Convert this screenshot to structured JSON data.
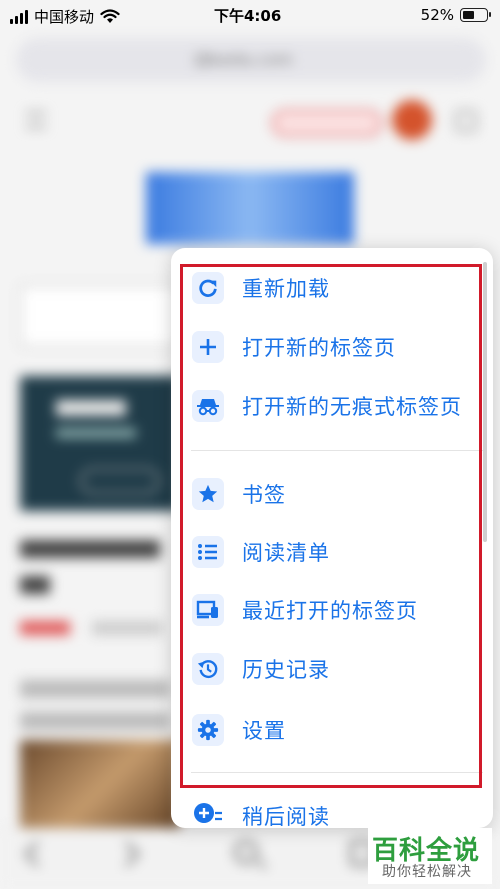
{
  "status_bar": {
    "carrier": "中国移动",
    "time": "下午4:06",
    "battery_level": "52%",
    "battery_fraction": 0.52
  },
  "background_page": {
    "url": "baidu.com"
  },
  "menu": {
    "items": [
      {
        "label": "重新加载",
        "icon": "reload-icon"
      },
      {
        "label": "打开新的标签页",
        "icon": "plus-icon"
      },
      {
        "label": "打开新的无痕式标签页",
        "icon": "incognito-icon"
      },
      {
        "label": "书签",
        "icon": "star-icon"
      },
      {
        "label": "阅读清单",
        "icon": "reading-list-icon"
      },
      {
        "label": "最近打开的标签页",
        "icon": "recent-tabs-icon"
      },
      {
        "label": "历史记录",
        "icon": "history-icon"
      },
      {
        "label": "设置",
        "icon": "gear-icon"
      },
      {
        "label": "稍后阅读",
        "icon": "read-later-icon"
      }
    ]
  },
  "watermark": {
    "title": "百科全说",
    "subtitle": "助你轻松解决"
  },
  "colors": {
    "accent": "#1a73e8",
    "icon_background": "#e8f0fe",
    "highlight_border": "#d11a2a",
    "watermark_green": "#2e9e3e"
  }
}
